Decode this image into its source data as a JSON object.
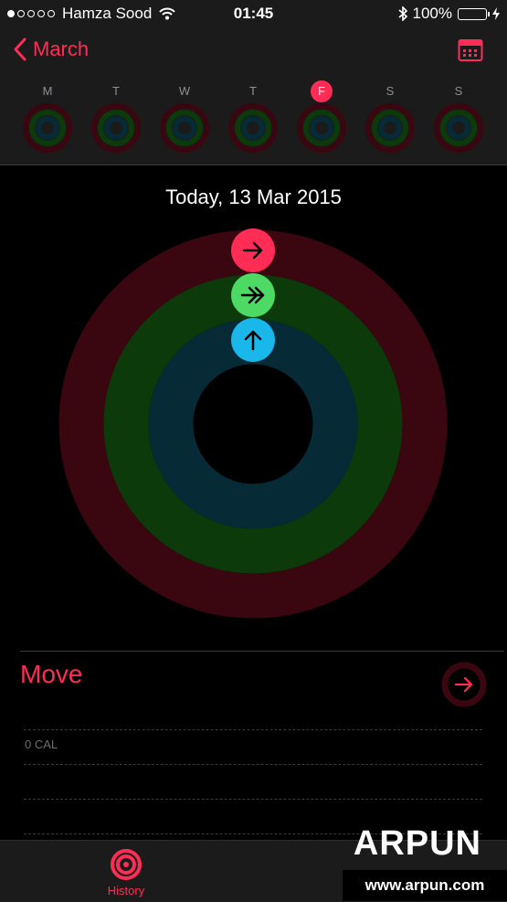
{
  "status_bar": {
    "carrier": "Hamza Sood",
    "time": "01:45",
    "battery": "100%",
    "signal_bars_filled": 1,
    "signal_bars_total": 5
  },
  "nav": {
    "back_label": "March",
    "calendar_icon": "calendar-icon"
  },
  "week": {
    "days": [
      {
        "letter": "M",
        "today": false
      },
      {
        "letter": "T",
        "today": false
      },
      {
        "letter": "W",
        "today": false
      },
      {
        "letter": "T",
        "today": false
      },
      {
        "letter": "F",
        "today": true
      },
      {
        "letter": "S",
        "today": false
      },
      {
        "letter": "S",
        "today": false
      }
    ]
  },
  "summary": {
    "date_title": "Today, 13 Mar 2015",
    "rings": [
      {
        "name": "move",
        "color": "#ff2d55",
        "track": "#3a0610",
        "icon": "arrow-right-icon",
        "progress": 0
      },
      {
        "name": "exercise",
        "color": "#4cd964",
        "track": "#0d3a0a",
        "icon": "double-arrow-right-icon",
        "progress": 0
      },
      {
        "name": "stand",
        "color": "#1ab7ea",
        "track": "#062a36",
        "icon": "arrow-up-icon",
        "progress": 0
      }
    ]
  },
  "move_section": {
    "label": "Move",
    "value": "0 CAL"
  },
  "tabbar": {
    "history_label": "History"
  },
  "watermark": {
    "brand": "ARPUN",
    "url": "www.arpun.com"
  },
  "colors": {
    "accent": "#ff2d55",
    "exercise": "#4cd964",
    "stand": "#1ab7ea"
  }
}
